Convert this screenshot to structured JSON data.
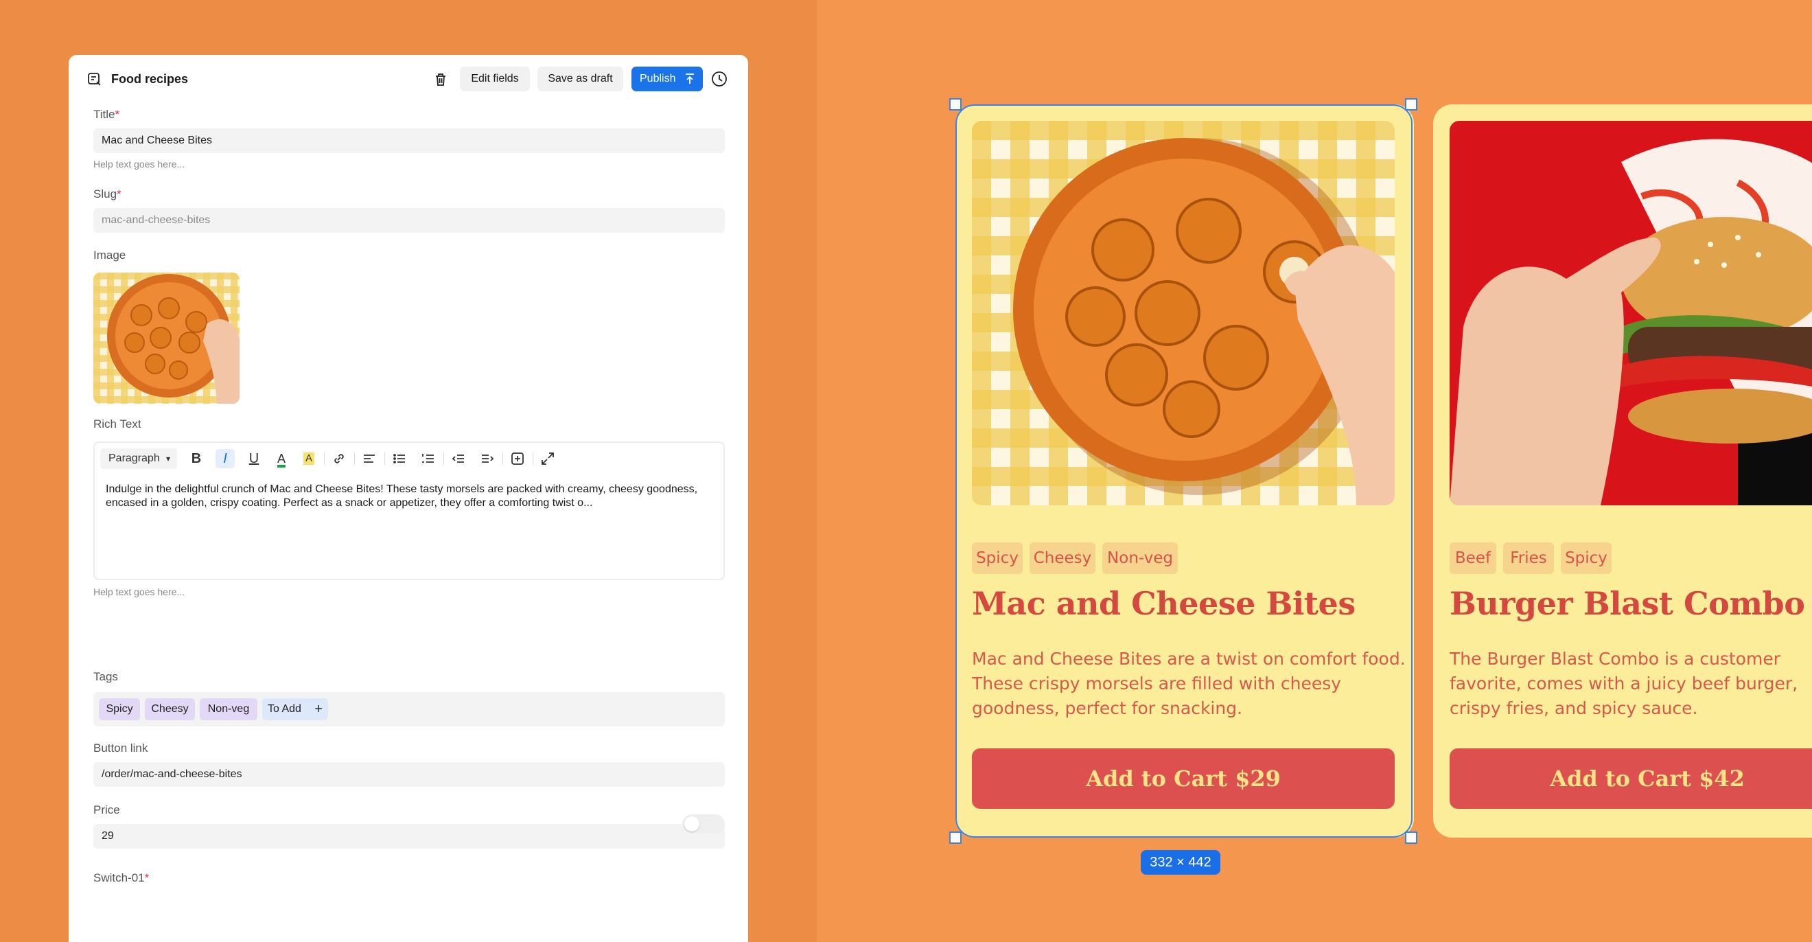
{
  "editor": {
    "collection_title": "Food recipes",
    "actions": {
      "edit_fields": "Edit fields",
      "save_draft": "Save as draft",
      "publish": "Publish"
    },
    "fields": {
      "title": {
        "label": "Title",
        "required_mark": "*",
        "value": "Mac and Cheese Bites",
        "help": "Help text goes here..."
      },
      "slug": {
        "label": "Slug",
        "required_mark": "*",
        "placeholder": "mac-and-cheese-bites"
      },
      "image": {
        "label": "Image"
      },
      "rich_text": {
        "label": "Rich Text",
        "block_type": "Paragraph",
        "content": "Indulge in the delightful crunch of Mac and Cheese Bites! These tasty morsels are packed with creamy, cheesy goodness, encased in a golden, crispy coating. Perfect as a snack or appetizer, they offer a comforting twist o...",
        "help": "Help text goes here..."
      },
      "tags": {
        "label": "Tags",
        "items": [
          "Spicy",
          "Cheesy",
          "Non-veg"
        ],
        "add_label": "To Add"
      },
      "button_link": {
        "label": "Button link",
        "value": "/order/mac-and-cheese-bites"
      },
      "price": {
        "label": "Price",
        "value": "29"
      },
      "switch": {
        "label": "Switch-01",
        "required_mark": "*",
        "on": false
      }
    }
  },
  "cards": [
    {
      "tags": [
        "Spicy",
        "Cheesy",
        "Non-veg"
      ],
      "title": "Mac and Cheese Bites",
      "description": "Mac and Cheese Bites are a twist on comfort food. These crispy morsels are filled with cheesy goodness, perfect for snacking.",
      "cta": "Add to Cart  $29"
    },
    {
      "tags": [
        "Beef",
        "Fries",
        "Spicy"
      ],
      "title": "Burger Blast Combo",
      "description": "The Burger Blast Combo is a customer favorite, comes with a juicy beef burger, crispy fries, and spicy sauce.",
      "cta": "Add to Cart  $42"
    }
  ],
  "selection": {
    "size_label": "332 × 442"
  },
  "colors": {
    "accent": "#1a73e8",
    "card_bg": "#fbed99",
    "card_red": "#dd5050",
    "background": "#f5964f"
  }
}
